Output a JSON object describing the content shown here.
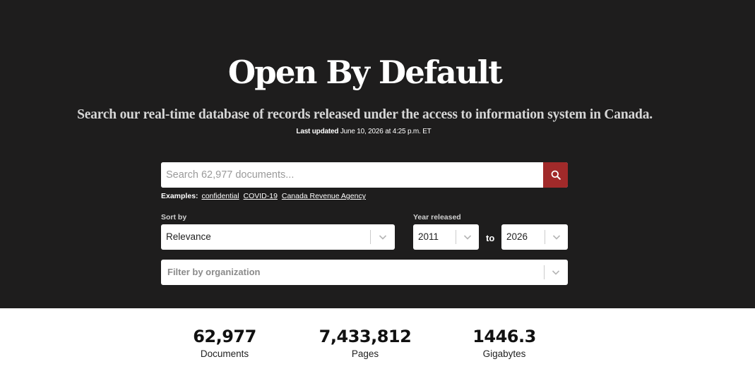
{
  "hero": {
    "title": "Open By Default",
    "subtitle": "Search our real-time database of records released under the access to information system in Canada.",
    "updated_prefix": "Last updated",
    "updated_date": "June 10, 2026 at 4:25 p.m. ET"
  },
  "search": {
    "placeholder": "Search 62,977 documents...",
    "button_icon": "search-icon",
    "button_color": "#a12a2a"
  },
  "examples": {
    "label": "Examples:",
    "items": [
      "confidential",
      "COVID-19",
      "Canada Revenue Agency"
    ]
  },
  "sort": {
    "label": "Sort by",
    "value": "Relevance"
  },
  "year": {
    "label": "Year released",
    "from": "2011",
    "to_label": "to",
    "to": "2026"
  },
  "organization": {
    "placeholder": "Filter by organization"
  },
  "stats": [
    {
      "value": "62,977",
      "label": "Documents"
    },
    {
      "value": "7,433,812",
      "label": "Pages"
    },
    {
      "value": "1446.3",
      "label": "Gigabytes"
    }
  ],
  "colors": {
    "hero_background": "#1e1d1d",
    "accent": "#a12a2a"
  }
}
